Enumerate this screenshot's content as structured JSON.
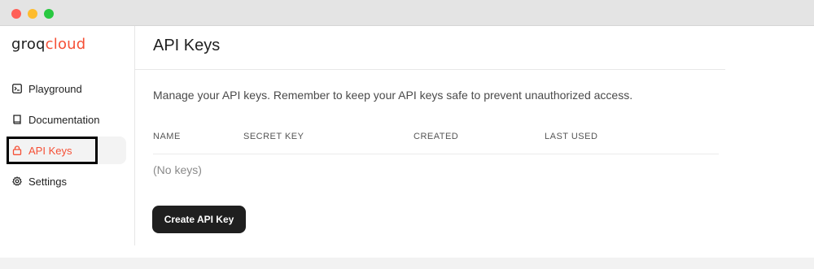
{
  "window": {
    "controls": [
      "close",
      "minimize",
      "maximize"
    ]
  },
  "sidebar": {
    "logo": {
      "part1": "groq",
      "part2": "cloud"
    },
    "items": [
      {
        "label": "Playground",
        "icon": "terminal-icon"
      },
      {
        "label": "Documentation",
        "icon": "book-icon"
      },
      {
        "label": "API Keys",
        "icon": "lock-icon",
        "active": true
      },
      {
        "label": "Settings",
        "icon": "gear-icon"
      }
    ]
  },
  "main": {
    "title": "API Keys",
    "description": "Manage your API keys. Remember to keep your API keys safe to prevent unauthorized access.",
    "table": {
      "columns": [
        "NAME",
        "SECRET KEY",
        "CREATED",
        "LAST USED"
      ],
      "empty_text": "(No keys)"
    },
    "create_button": "Create API Key"
  },
  "colors": {
    "accent": "#f55036",
    "button_bg": "#1f1f1f"
  }
}
